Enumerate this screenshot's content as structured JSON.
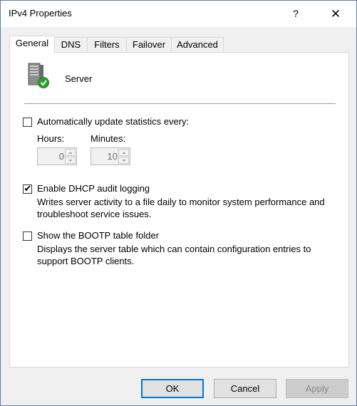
{
  "window": {
    "title": "IPv4 Properties",
    "help_label": "?",
    "close_label": "✕"
  },
  "tabs": [
    {
      "label": "General",
      "active": true
    },
    {
      "label": "DNS",
      "active": false
    },
    {
      "label": "Filters",
      "active": false
    },
    {
      "label": "Failover",
      "active": false
    },
    {
      "label": "Advanced",
      "active": false
    }
  ],
  "general": {
    "server_icon": "server-icon",
    "server_label": "Server",
    "auto_update": {
      "label": "Automatically update statistics every:",
      "checked": false,
      "hours_label": "Hours:",
      "hours_value": "0",
      "minutes_label": "Minutes:",
      "minutes_value": "10"
    },
    "dhcp_audit": {
      "label": "Enable DHCP audit logging",
      "checked": true,
      "check_glyph": "✔",
      "description_line1": "Writes server activity to a file daily to monitor system performance and",
      "description_line2": "troubleshoot service issues."
    },
    "bootp": {
      "label": "Show the BOOTP table folder",
      "checked": false,
      "description_line1": "Displays the server table which can contain configuration entries to",
      "description_line2": "support BOOTP clients."
    }
  },
  "buttons": {
    "ok": "OK",
    "cancel": "Cancel",
    "apply": "Apply"
  },
  "colors": {
    "accent": "#0078d7",
    "status_ok": "#2ca02c"
  }
}
